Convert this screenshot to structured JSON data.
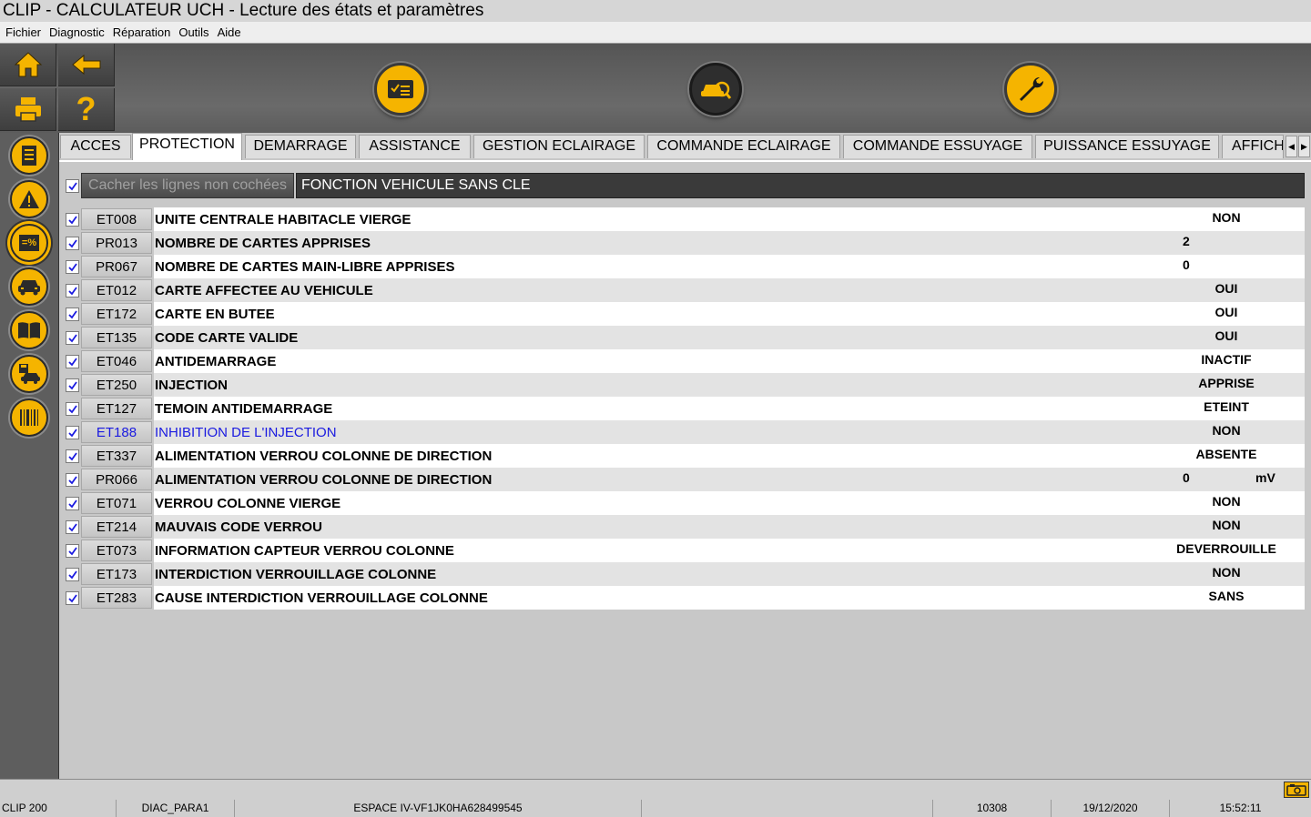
{
  "window": {
    "title": "CLIP - CALCULATEUR UCH - Lecture des états et paramètres"
  },
  "menu": [
    "Fichier",
    "Diagnostic",
    "Réparation",
    "Outils",
    "Aide"
  ],
  "toolbar": {
    "left_buttons": [
      "home-icon",
      "back-arrow-icon",
      "printer-icon",
      "help-icon"
    ],
    "big_buttons": [
      "checklist-icon",
      "vehicle-diagnostic-icon",
      "wrench-icon"
    ],
    "help_label": "?"
  },
  "sidebar": {
    "items": [
      "document-icon",
      "warning-icon",
      "parameters-icon",
      "car-icon",
      "manual-icon",
      "car-save-icon",
      "barcode-icon"
    ],
    "active_index": 2,
    "parameters_label": "=%"
  },
  "tabs": [
    "ACCES",
    "PROTECTION",
    "DEMARRAGE",
    "ASSISTANCE",
    "GESTION ECLAIRAGE",
    "COMMANDE ECLAIRAGE",
    "COMMANDE ESSUYAGE",
    "PUISSANCE ESSUYAGE",
    "AFFICH"
  ],
  "active_tab": 1,
  "filter": {
    "checkbox_checked": true,
    "hide_label": "Cacher les lignes non cochées",
    "function_title": "FONCTION VEHICULE SANS CLE"
  },
  "rows": [
    {
      "code": "ET008",
      "label": "UNITE CENTRALE HABITACLE VIERGE",
      "value": "NON",
      "unit": "",
      "checked": true
    },
    {
      "code": "PR013",
      "label": "NOMBRE DE CARTES APPRISES",
      "value": "2",
      "unit": "",
      "checked": true
    },
    {
      "code": "PR067",
      "label": "NOMBRE DE CARTES MAIN-LIBRE APPRISES",
      "value": "0",
      "unit": "",
      "checked": true
    },
    {
      "code": "ET012",
      "label": "CARTE AFFECTEE AU VEHICULE",
      "value": "OUI",
      "unit": "",
      "checked": true
    },
    {
      "code": "ET172",
      "label": "CARTE EN BUTEE",
      "value": "OUI",
      "unit": "",
      "checked": true
    },
    {
      "code": "ET135",
      "label": "CODE CARTE VALIDE",
      "value": "OUI",
      "unit": "",
      "checked": true
    },
    {
      "code": "ET046",
      "label": "ANTIDEMARRAGE",
      "value": "INACTIF",
      "unit": "",
      "checked": true
    },
    {
      "code": "ET250",
      "label": "INJECTION",
      "value": "APPRISE",
      "unit": "",
      "checked": true
    },
    {
      "code": "ET127",
      "label": "TEMOIN ANTIDEMARRAGE",
      "value": "ETEINT",
      "unit": "",
      "checked": true
    },
    {
      "code": "ET188",
      "label": "INHIBITION DE L'INJECTION",
      "value": "NON",
      "unit": "",
      "checked": true,
      "selected": true
    },
    {
      "code": "ET337",
      "label": "ALIMENTATION VERROU COLONNE DE DIRECTION",
      "value": "ABSENTE",
      "unit": "",
      "checked": true
    },
    {
      "code": "PR066",
      "label": "ALIMENTATION VERROU COLONNE DE DIRECTION",
      "value": "0",
      "unit": "mV",
      "checked": true
    },
    {
      "code": "ET071",
      "label": "VERROU COLONNE VIERGE",
      "value": "NON",
      "unit": "",
      "checked": true
    },
    {
      "code": "ET214",
      "label": "MAUVAIS CODE VERROU",
      "value": "NON",
      "unit": "",
      "checked": true
    },
    {
      "code": "ET073",
      "label": "INFORMATION CAPTEUR VERROU COLONNE",
      "value": "DEVERROUILLE",
      "unit": "",
      "checked": true
    },
    {
      "code": "ET173",
      "label": "INTERDICTION VERROUILLAGE COLONNE",
      "value": "NON",
      "unit": "",
      "checked": true
    },
    {
      "code": "ET283",
      "label": "CAUSE INTERDICTION VERROUILLAGE COLONNE",
      "value": "SANS",
      "unit": "",
      "checked": true
    }
  ],
  "status": {
    "device": "CLIP 200",
    "diag": "DIAC_PARA1",
    "vehicle": "ESPACE IV-VF1JK0HA628499545",
    "extra": "",
    "code": "10308",
    "date": "19/12/2020",
    "time": "15:52:11"
  },
  "colors": {
    "accent": "#f5b400",
    "selected_text": "#1a1ae0",
    "toolbar": "#5a5a5a"
  }
}
